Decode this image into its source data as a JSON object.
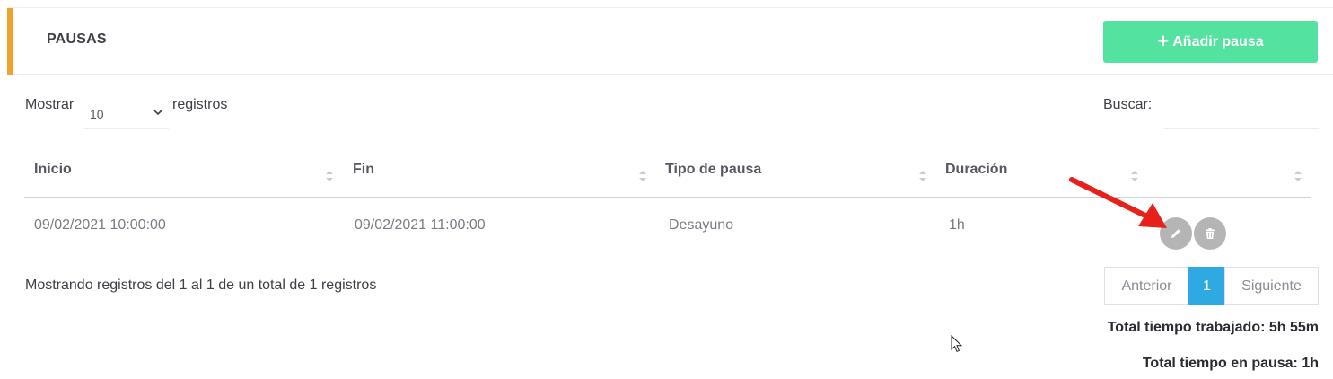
{
  "header": {
    "title": "PAUSAS",
    "add_button_label": "Añadir pausa",
    "add_button_color": "#53e29f",
    "accent_color": "#f0a22e"
  },
  "controls": {
    "show_label": "Mostrar",
    "page_length": "10",
    "records_label": "registros",
    "search_label": "Buscar:",
    "search_value": ""
  },
  "table": {
    "columns": [
      "Inicio",
      "Fin",
      "Tipo de pausa",
      "Duración",
      ""
    ],
    "rows": [
      {
        "inicio": "09/02/2021 10:00:00",
        "fin": "09/02/2021 11:00:00",
        "tipo": "Desayuno",
        "duracion": "1h"
      }
    ],
    "actions": [
      "edit-icon",
      "trash-icon"
    ]
  },
  "footer": {
    "info": "Mostrando registros del 1 al 1 de un total de 1 registros",
    "pagination": {
      "previous": "Anterior",
      "current": "1",
      "next": "Siguiente",
      "active_color": "#2ea9e2"
    },
    "total_worked": "Total tiempo trabajado: 5h 55m",
    "total_paused": "Total tiempo en pausa: 1h"
  }
}
